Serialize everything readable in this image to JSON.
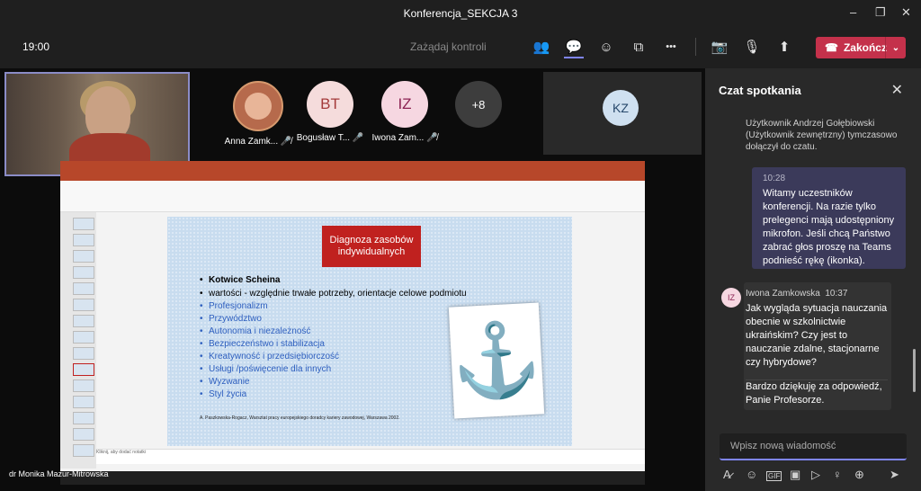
{
  "window": {
    "title": "Konferencja_SEKCJA 3",
    "controls": [
      "–",
      "❐",
      "✕"
    ]
  },
  "toolbar": {
    "time": "19:00",
    "request_control": "Zażądaj kontroli",
    "end_label": "Zakończ",
    "icons": {
      "people": "👥",
      "chat": "💬",
      "reactions": "☺",
      "rooms": "⧉",
      "more": "•••",
      "camera": "📷",
      "mic": "🎙",
      "share": "⬆",
      "phone": "☎",
      "caret": "⌄"
    },
    "accent": "#7f85f5",
    "end_color": "#c4314b"
  },
  "participants": [
    {
      "initials": "",
      "name": "Anna Zamk...",
      "mic": "🎤̸"
    },
    {
      "initials": "BT",
      "name": "Bogusław T...",
      "mic": "🎤"
    },
    {
      "initials": "IZ",
      "name": "Iwona Zam...",
      "mic": "🎤̸"
    },
    {
      "initials": "+8",
      "name": ""
    },
    {
      "initials": "KZ",
      "name": ""
    }
  ],
  "presenter_name": "dr Monika Mazur-Mitrowska",
  "slide": {
    "title": "Diagnoza zasobów indywidualnych",
    "bullets_black": [
      "Kotwice Scheina",
      "wartości - względnie trwałe potrzeby, orientacje celowe podmiotu"
    ],
    "bullets_blue": [
      "Profesjonalizm",
      "Przywództwo",
      "Autonomia i niezależność",
      "Bezpieczeństwo i stabilizacja",
      "Kreatywność i przedsiębiorczość",
      "Usługi /poświęcenie dla innych",
      "Wyzwanie",
      "Styl życia"
    ],
    "reference": "A. Paszkowska-Rogacz, Warsztat pracy europejskiego doradcy kariery zawodowej, Warszawa 2002.",
    "notes": "Kliknij, aby dodać notatki",
    "anchor": "⚓"
  },
  "chat": {
    "header": "Czat spotkania",
    "close": "✕",
    "system_msg": "Użytkownik Andrzej Gołębiowski (Użytkownik zewnętrzny) tymczasowo dołączył do czatu.",
    "msg_me_time": "10:28",
    "msg_me_text": "Witamy uczestników konferencji. Na razie tylko prelegenci mają udostępniony mikrofon. Jeśli chcą Państwo zabrać głos proszę na Teams podnieść rękę (ikonka).",
    "iz_initials": "IZ",
    "iz_name": "Iwona Zamkowska",
    "iz_time": "10:37",
    "iz_text1": "Jak wygląda sytuacja nauczania obecnie w szkolnictwie ukraińskim? Czy jest to nauczanie zdalne, stacjonarne czy hybrydowe?",
    "iz_text2": "Bardzo dziękuję za odpowiedź, Panie Profesorze.",
    "input_placeholder": "Wpisz nową wiadomość",
    "compose_icons": [
      "A̷",
      "☺",
      "GIF",
      "▣",
      "▷",
      "♀",
      "⊕",
      "➤"
    ]
  }
}
